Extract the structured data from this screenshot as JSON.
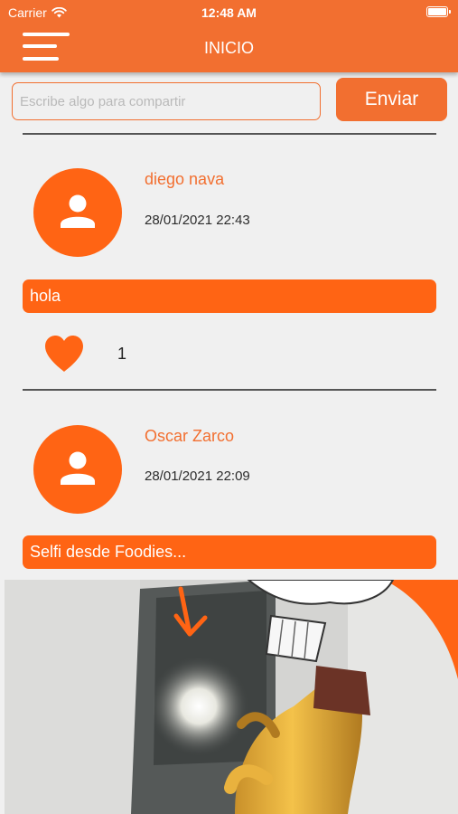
{
  "status": {
    "carrier": "Carrier",
    "time": "12:48 AM"
  },
  "header": {
    "title": "INICIO"
  },
  "compose": {
    "placeholder": "Escribe algo para compartir",
    "send_label": "Enviar"
  },
  "posts": [
    {
      "author": "diego nava",
      "date": "28/01/2021 22:43",
      "text": "hola",
      "likes": "1"
    },
    {
      "author": "Oscar Zarco",
      "date": "28/01/2021 22:09",
      "text": "Selfi desde Foodies..."
    }
  ],
  "colors": {
    "primary": "#f26f30",
    "accent": "#ff6414",
    "background": "#f0f0f0"
  },
  "icons": [
    "wifi-icon",
    "battery-icon",
    "menu-icon",
    "user-icon",
    "heart-icon"
  ]
}
